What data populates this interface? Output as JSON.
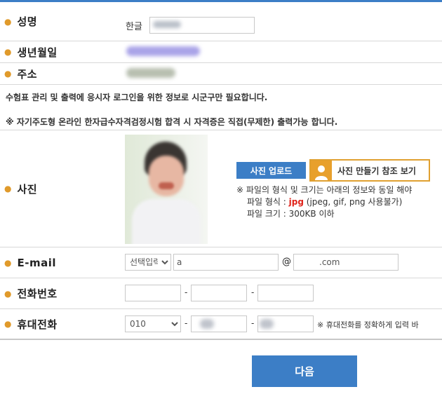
{
  "form": {
    "name": {
      "label": "성명",
      "prefix": "한글"
    },
    "birth": {
      "label": "생년월일"
    },
    "address": {
      "label": "주소"
    },
    "notice1": "수험표 관리 및 출력에 응시자 로그인을 위한 정보로 시군구만 필요합니다.",
    "notice2": "※ 자기주도형 온라인 한자급수자격검정시험 합격 시 자격증은 직접(무제한) 출력가능 합니다.",
    "photo": {
      "label": "사진",
      "upload_button": "사진 업로드",
      "reference_button": "사진 만들기 참조 보기",
      "info_line1": "※ 파일의 형식 및 크기는 아래의 정보와 동일 해야",
      "info_format_prefix": "파일 형식 : ",
      "info_format_highlight": "jpg",
      "info_format_suffix": " (jpeg, gif, png 사용불가)",
      "info_size": "파일 크기 : 300KB 이하"
    },
    "email": {
      "label": "E-mail",
      "select_value": "선택입력",
      "local_value": "a",
      "at": "@",
      "domain_value": ".com"
    },
    "phone": {
      "label": "전화번호",
      "dash": "-"
    },
    "mobile": {
      "label": "휴대전화",
      "prefix_value": "010",
      "dash": "-",
      "note": "※ 휴대전화를 정확하게 입력 바"
    },
    "next_button": "다음"
  },
  "colors": {
    "accent": "#3c7ec6",
    "bullet": "#e09a2b",
    "reference_border": "#e0a030",
    "highlight_red": "#e0231a"
  },
  "icons": {
    "reference": "person-icon",
    "bullet": "bullet-dot"
  }
}
